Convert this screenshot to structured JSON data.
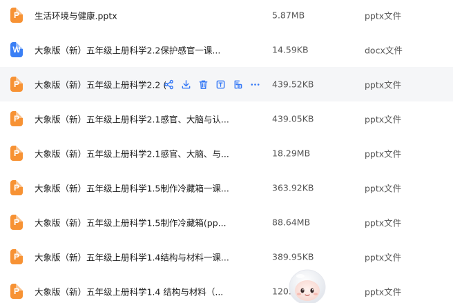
{
  "files": [
    {
      "name": "生活环境与健康.pptx",
      "size": "5.87MB",
      "type": "pptx文件",
      "icon": "P",
      "kind": "pptx"
    },
    {
      "name": "大象版（新）五年级上册科学2.2保护感官一课...",
      "size": "14.59KB",
      "type": "docx文件",
      "icon": "W",
      "kind": "docx"
    },
    {
      "name": "大象版（新）五年级上册科学2.2 (",
      "size": "439.52KB",
      "type": "pptx文件",
      "icon": "P",
      "kind": "pptx"
    },
    {
      "name": "大象版（新）五年级上册科学2.1感官、大脑与认...",
      "size": "439.05KB",
      "type": "pptx文件",
      "icon": "P",
      "kind": "pptx"
    },
    {
      "name": "大象版（新）五年级上册科学2.1感官、大脑、与...",
      "size": "18.29MB",
      "type": "pptx文件",
      "icon": "P",
      "kind": "pptx"
    },
    {
      "name": "大象版（新）五年级上册科学1.5制作冷藏箱一课...",
      "size": "363.92KB",
      "type": "pptx文件",
      "icon": "P",
      "kind": "pptx"
    },
    {
      "name": "大象版（新）五年级上册科学1.5制作冷藏箱(pp...",
      "size": "88.64MB",
      "type": "pptx文件",
      "icon": "P",
      "kind": "pptx"
    },
    {
      "name": "大象版（新）五年级上册科学1.4结构与材料一课...",
      "size": "389.95KB",
      "type": "pptx文件",
      "icon": "P",
      "kind": "pptx"
    },
    {
      "name": "大象版（新）五年级上册科学1.4 结构与材料（...",
      "size": "120.",
      "type": "pptx文件",
      "icon": "P",
      "kind": "pptx"
    }
  ],
  "hover_actions": [
    "share-icon",
    "download-icon",
    "delete-icon",
    "text-extract-icon",
    "copy-to-icon",
    "more-icon"
  ],
  "colors": {
    "pptx": "#f79234",
    "docx": "#3a7ff5",
    "action": "#3478f6",
    "hover_bg": "#f5f6f8"
  }
}
